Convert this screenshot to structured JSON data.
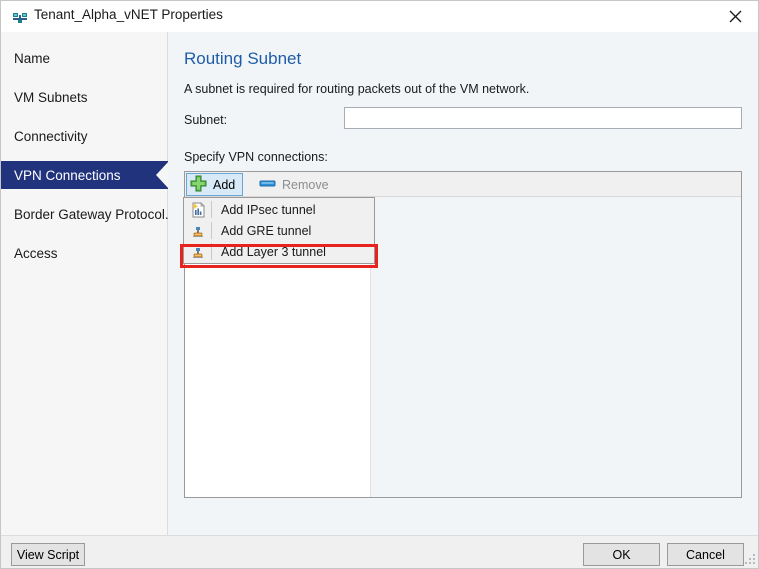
{
  "window": {
    "title": "Tenant_Alpha_vNET Properties",
    "title_icon": "network-vnet-icon",
    "close_label": "close-icon"
  },
  "sidebar": {
    "items": [
      {
        "label": "Name",
        "selected": false
      },
      {
        "label": "VM Subnets",
        "selected": false
      },
      {
        "label": "Connectivity",
        "selected": false
      },
      {
        "label": "VPN Connections",
        "selected": true
      },
      {
        "label": "Border Gateway Protocol...",
        "selected": false
      },
      {
        "label": "Access",
        "selected": false
      }
    ]
  },
  "pane": {
    "title": "Routing Subnet",
    "description": "A subnet is required for routing packets out of the VM network.",
    "subnet_label": "Subnet:",
    "subnet_value": "",
    "subnet_placeholder": "",
    "specify_label": "Specify VPN connections:"
  },
  "toolbar": {
    "add_label": "Add",
    "add_icon": "green-plus-icon",
    "remove_label": "Remove",
    "remove_icon": "blue-minus-icon"
  },
  "menu": {
    "items": [
      {
        "label": "Add IPsec tunnel",
        "icon": "new-document-icon",
        "highlighted": false
      },
      {
        "label": "Add GRE tunnel",
        "icon": "gateway-icon",
        "highlighted": false
      },
      {
        "label": "Add Layer 3 tunnel",
        "icon": "gateway-icon",
        "highlighted": true
      }
    ]
  },
  "footer": {
    "view_script_label": "View Script",
    "ok_label": "OK",
    "cancel_label": "Cancel"
  },
  "colors": {
    "accent_title": "#1f5ca8",
    "selected_nav_bg": "#22337e",
    "highlight_red": "#e8231e",
    "toolbar_active_bg": "#d8eaf7",
    "pane_bg": "#f1f5f7"
  }
}
